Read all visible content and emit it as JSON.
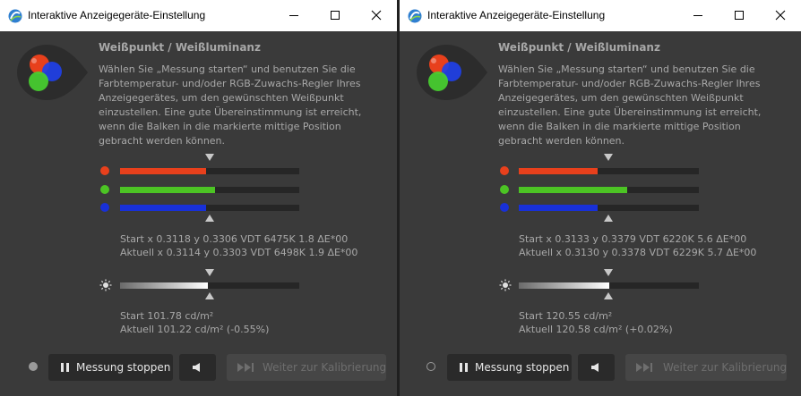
{
  "windows": [
    {
      "title": "Interaktive Anzeigegeräte-Einstellung",
      "heading": "Weißpunkt / Weißluminanz",
      "instruction_lines": [
        "Wählen Sie „Messung starten“ und benutzen Sie die",
        "Farbtemperatur- und/oder RGB-Zuwachs-Regler Ihres",
        "Anzeigegerätes, um den gewünschten Weißpunkt",
        "einzustellen. Eine gute Übereinstimmung ist erreicht,",
        "wenn die Balken in die markierte mittige Position",
        "gebracht werden können."
      ],
      "channels": [
        {
          "name": "red",
          "color": "#e8401c",
          "level": 0.48
        },
        {
          "name": "green",
          "color": "#4cc424",
          "level": 0.53
        },
        {
          "name": "blue",
          "color": "#1830d8",
          "level": 0.48
        }
      ],
      "rgb_start": "Start x 0.3118 y 0.3306 VDT 6475K 1.8 ΔE*00",
      "rgb_current": "Aktuell x 0.3114 y 0.3303 VDT 6498K 1.9 ΔE*00",
      "luminance_level": 0.49,
      "lum_start": "Start 101.78 cd/m²",
      "lum_current": "Aktuell 101.22 cd/m² (-0.55%)",
      "status_style": "filled",
      "stop_label": "Messung stoppen",
      "next_label": "Weiter zur Kalibrierung"
    },
    {
      "title": "Interaktive Anzeigegeräte-Einstellung",
      "heading": "Weißpunkt / Weißluminanz",
      "instruction_lines": [
        "Wählen Sie „Messung starten“ und benutzen Sie die",
        "Farbtemperatur- und/oder RGB-Zuwachs-Regler Ihres",
        "Anzeigegerätes, um den gewünschten Weißpunkt",
        "einzustellen. Eine gute Übereinstimmung ist erreicht,",
        "wenn die Balken in die markierte mittige Position",
        "gebracht werden können."
      ],
      "channels": [
        {
          "name": "red",
          "color": "#e8401c",
          "level": 0.44
        },
        {
          "name": "green",
          "color": "#4cc424",
          "level": 0.6
        },
        {
          "name": "blue",
          "color": "#1830d8",
          "level": 0.44
        }
      ],
      "rgb_start": "Start x 0.3133 y 0.3379 VDT 6220K 5.6 ΔE*00",
      "rgb_current": "Aktuell x 0.3130 y 0.3378 VDT 6229K 5.7 ΔE*00",
      "luminance_level": 0.5,
      "lum_start": "Start 120.55 cd/m²",
      "lum_current": "Aktuell 120.58 cd/m² (+0.02%)",
      "status_style": "hollow",
      "stop_label": "Messung stoppen",
      "next_label": "Weiter zur Kalibrierung"
    }
  ]
}
